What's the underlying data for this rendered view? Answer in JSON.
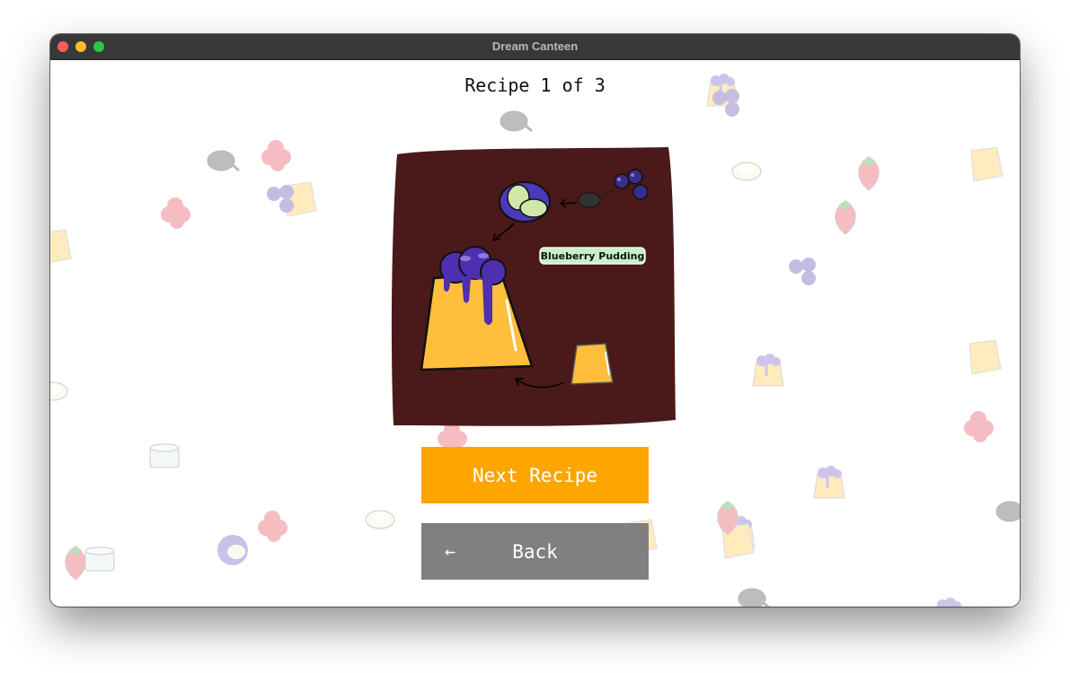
{
  "window": {
    "title": "Dream Canteen"
  },
  "recipe": {
    "counter": "Recipe 1 of 3",
    "name": "Blueberry Pudding"
  },
  "buttons": {
    "next_label": "Next Recipe",
    "back_arrow": "←",
    "back_label": "Back"
  },
  "colors": {
    "next_button": "#ffa500",
    "back_button": "#808080",
    "card_background": "#4a1919"
  }
}
